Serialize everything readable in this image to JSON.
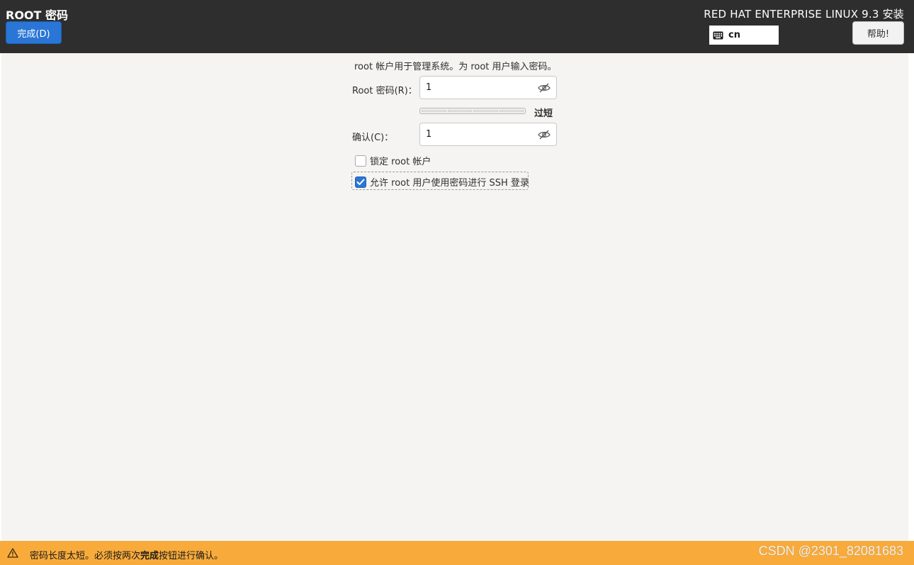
{
  "header": {
    "spoke_title": "ROOT 密码",
    "done_button": "完成(D)",
    "product_title": "RED HAT ENTERPRISE LINUX 9.3 安装",
    "keyboard_layout": "cn",
    "help_button": "帮助!"
  },
  "form": {
    "description": "root 帐户用于管理系统。为 root 用户输入密码。",
    "root_password_label": "Root 密码(R)：",
    "root_password_value": "1",
    "strength_label": "过短",
    "confirm_label": "确认(C)：",
    "confirm_value": "1",
    "lock_root_label": "锁定 root 帐户",
    "lock_root_checked": false,
    "allow_ssh_label": "允许 root 用户使用密码进行 SSH 登录",
    "allow_ssh_checked": true
  },
  "warning": {
    "text_before": "密码长度太短。必须按两次",
    "text_bold": "完成",
    "text_after": "按钮进行确认。"
  },
  "watermark": "CSDN @2301_82081683",
  "colors": {
    "header_bg": "#2e2e2e",
    "accent": "#2a76d6",
    "content_bg": "#f5f4f2",
    "warning_bg": "#f8ab3b"
  },
  "icons": {
    "keyboard": "keyboard-icon",
    "reveal": "eye-slash-icon",
    "warning": "warning-triangle-icon",
    "check": "checkmark-icon"
  }
}
